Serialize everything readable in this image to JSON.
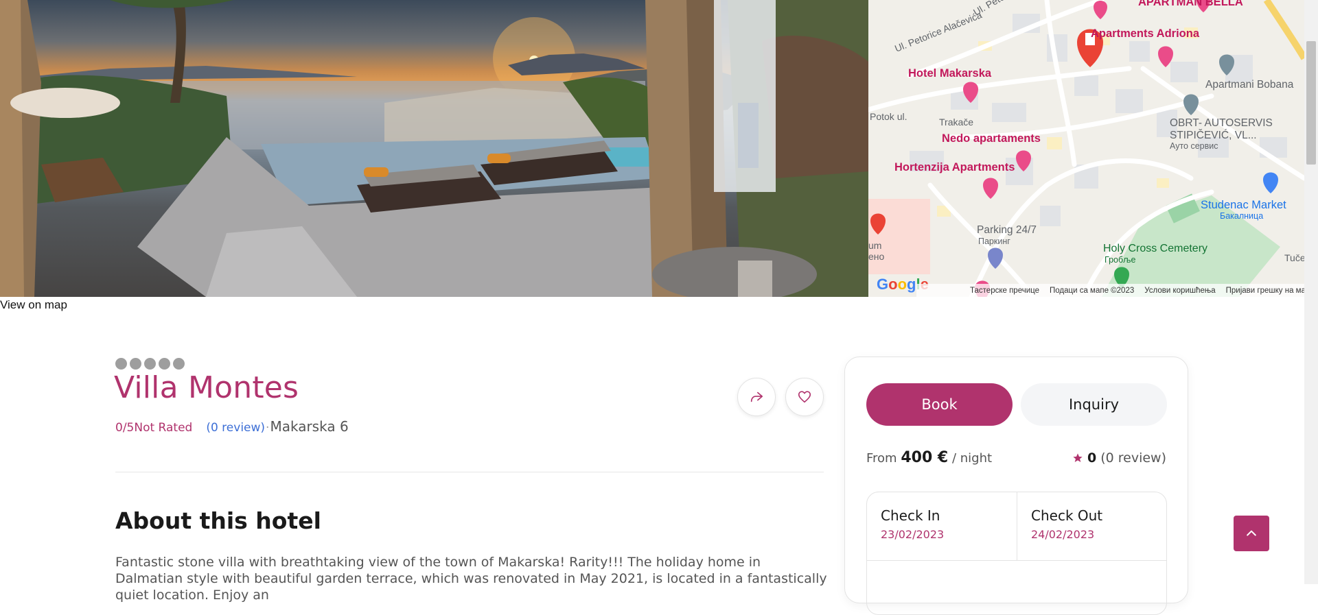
{
  "map": {
    "labels": {
      "apartman_bella": "APARTMAN BELLA",
      "apartments_adriona": "Apartments Adriona",
      "hotel_makarska": "Hotel Makarska",
      "apartmani_bobana": "Apartmani Bobana",
      "obrt_autoservis": "OBRT- AUTOSERVIS",
      "stipicevic": "STIPIČEVIĆ, VL...",
      "auto_servis": "Ауто сервис",
      "nedo_apartamenti": "Nedo apartaments",
      "hortenzija": "Hortenzija Apartments",
      "parking": "Parking 24/7",
      "parking_sub": "Паркинг",
      "studenac": "Studenac Market",
      "studenac_sub": "Бакалница",
      "cemetery": "Holy Cross Cemetery",
      "cemetery_sub": "Гробље",
      "trakace": "Trakače",
      "potok": "Potok ul.",
      "petorice": "Ul. Petorice Alačevića",
      "petorice2": "Ul. Peto",
      "tuce": "Tuče",
      "um": "um",
      "eno": "ено"
    },
    "google": "Google",
    "attribution": [
      "Тастерске пречице",
      "Подаци са мапе ©2023",
      "Услови коришћења",
      "Пријави грешку на мапи"
    ]
  },
  "view_on_map": "View on map",
  "hotel": {
    "name": "Villa Montes",
    "score": "0/5Not Rated",
    "reviews_link": "(0 review)",
    "separator": "·",
    "location": "Makarska 6",
    "stars": 0
  },
  "about": {
    "heading": "About this hotel",
    "text": "Fantastic stone villa with breathtaking view of the town of Makarska! Rarity!!! The holiday home in Dalmatian style with beautiful garden terrace, which was renovated in May 2021, is located in a fantastically quiet location. Enjoy an"
  },
  "booking": {
    "tab_book": "Book",
    "tab_inquiry": "Inquiry",
    "price_from": "From",
    "price_value": "400 €",
    "price_unit": "/ night",
    "rating_value": "0",
    "rating_reviews": "(0 review)",
    "check_in_label": "Check In",
    "check_in_value": "23/02/2023",
    "check_out_label": "Check Out",
    "check_out_value": "24/02/2023"
  },
  "colors": {
    "accent": "#b0336d",
    "link": "#3d6fd6"
  }
}
